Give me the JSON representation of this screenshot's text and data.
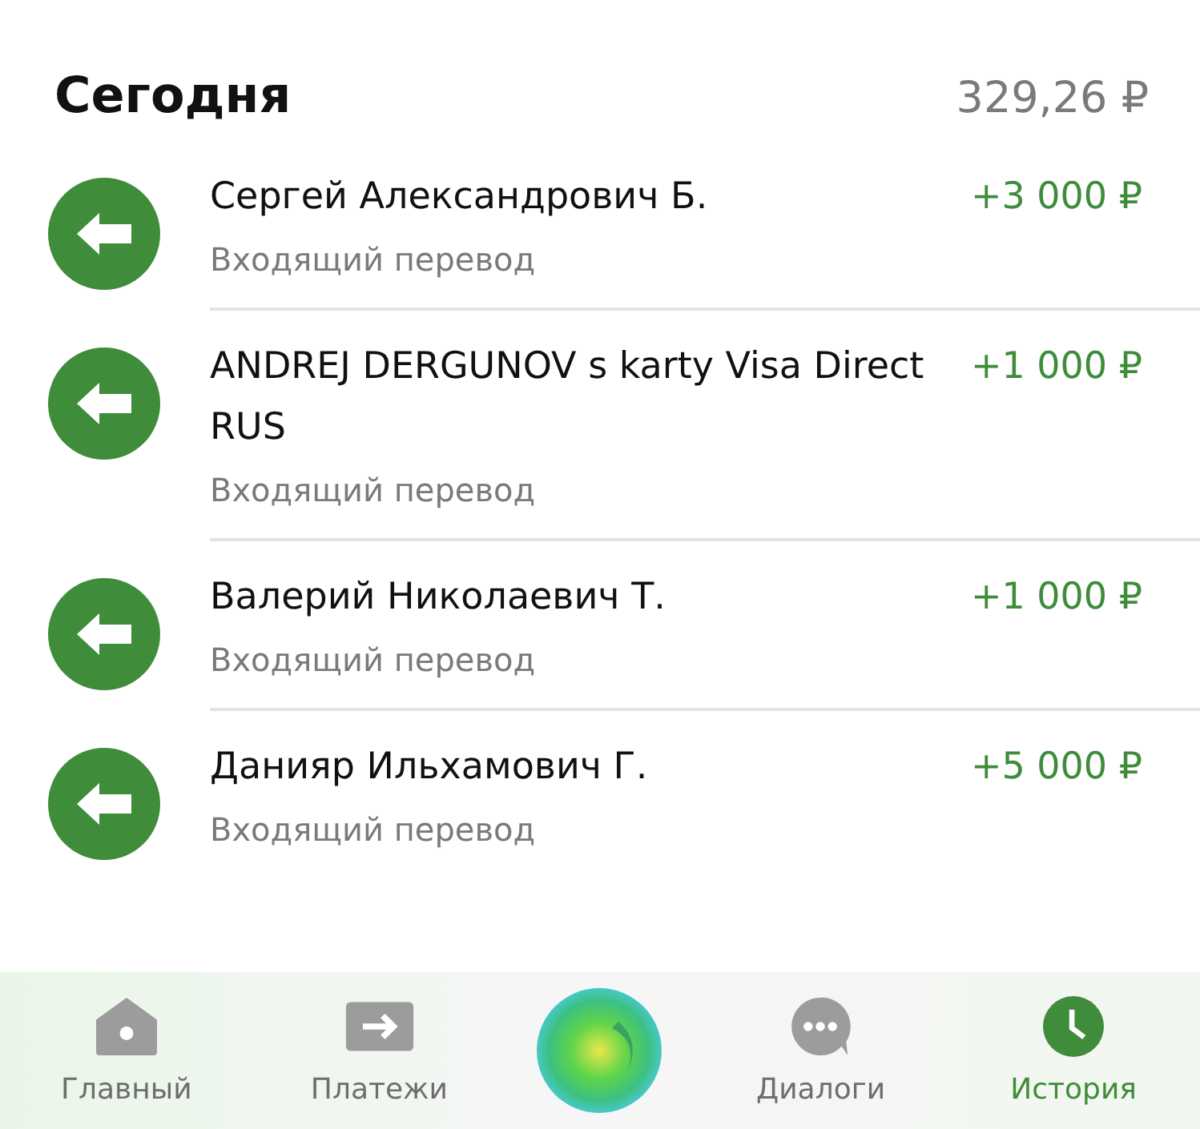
{
  "header": {
    "title": "Сегодня",
    "total": "329,26 ₽"
  },
  "transactions": [
    {
      "name": "Сергей Александрович Б.",
      "type": "Входящий перевод",
      "amount": "+3 000 ₽"
    },
    {
      "name": "ANDREJ DERGUNOV s karty  Visa Direct  RUS",
      "type": "Входящий перевод",
      "amount": "+1 000 ₽"
    },
    {
      "name": "Валерий Николаевич Т.",
      "type": "Входящий перевод",
      "amount": "+1 000 ₽"
    },
    {
      "name": "Данияр Ильхамович Г.",
      "type": "Входящий перевод",
      "amount": "+5 000 ₽"
    }
  ],
  "tabs": [
    {
      "label": "Главный",
      "selected": false
    },
    {
      "label": "Платежи",
      "selected": false
    },
    {
      "label": "Диалоги",
      "selected": false
    },
    {
      "label": "История",
      "selected": true
    }
  ]
}
